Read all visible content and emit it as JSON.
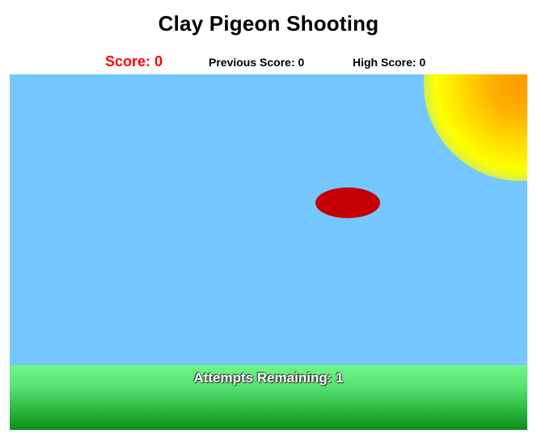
{
  "header": {
    "title": "Clay Pigeon Shooting"
  },
  "scoreboard": {
    "score": "Score: 0",
    "previous_score": "Previous Score: 0",
    "high_score": "High Score: 0"
  },
  "game": {
    "attempts_remaining": "Attempts Remaining: 1",
    "colors": {
      "sky": "#75c8ff",
      "clay_pigeon": "#c40000",
      "sun_core": "#ff9a00",
      "sun_edge": "#ffff00",
      "ground_top": "#6ff887",
      "ground_bottom": "#0c8f1b",
      "score_text": "#ff0000"
    }
  }
}
